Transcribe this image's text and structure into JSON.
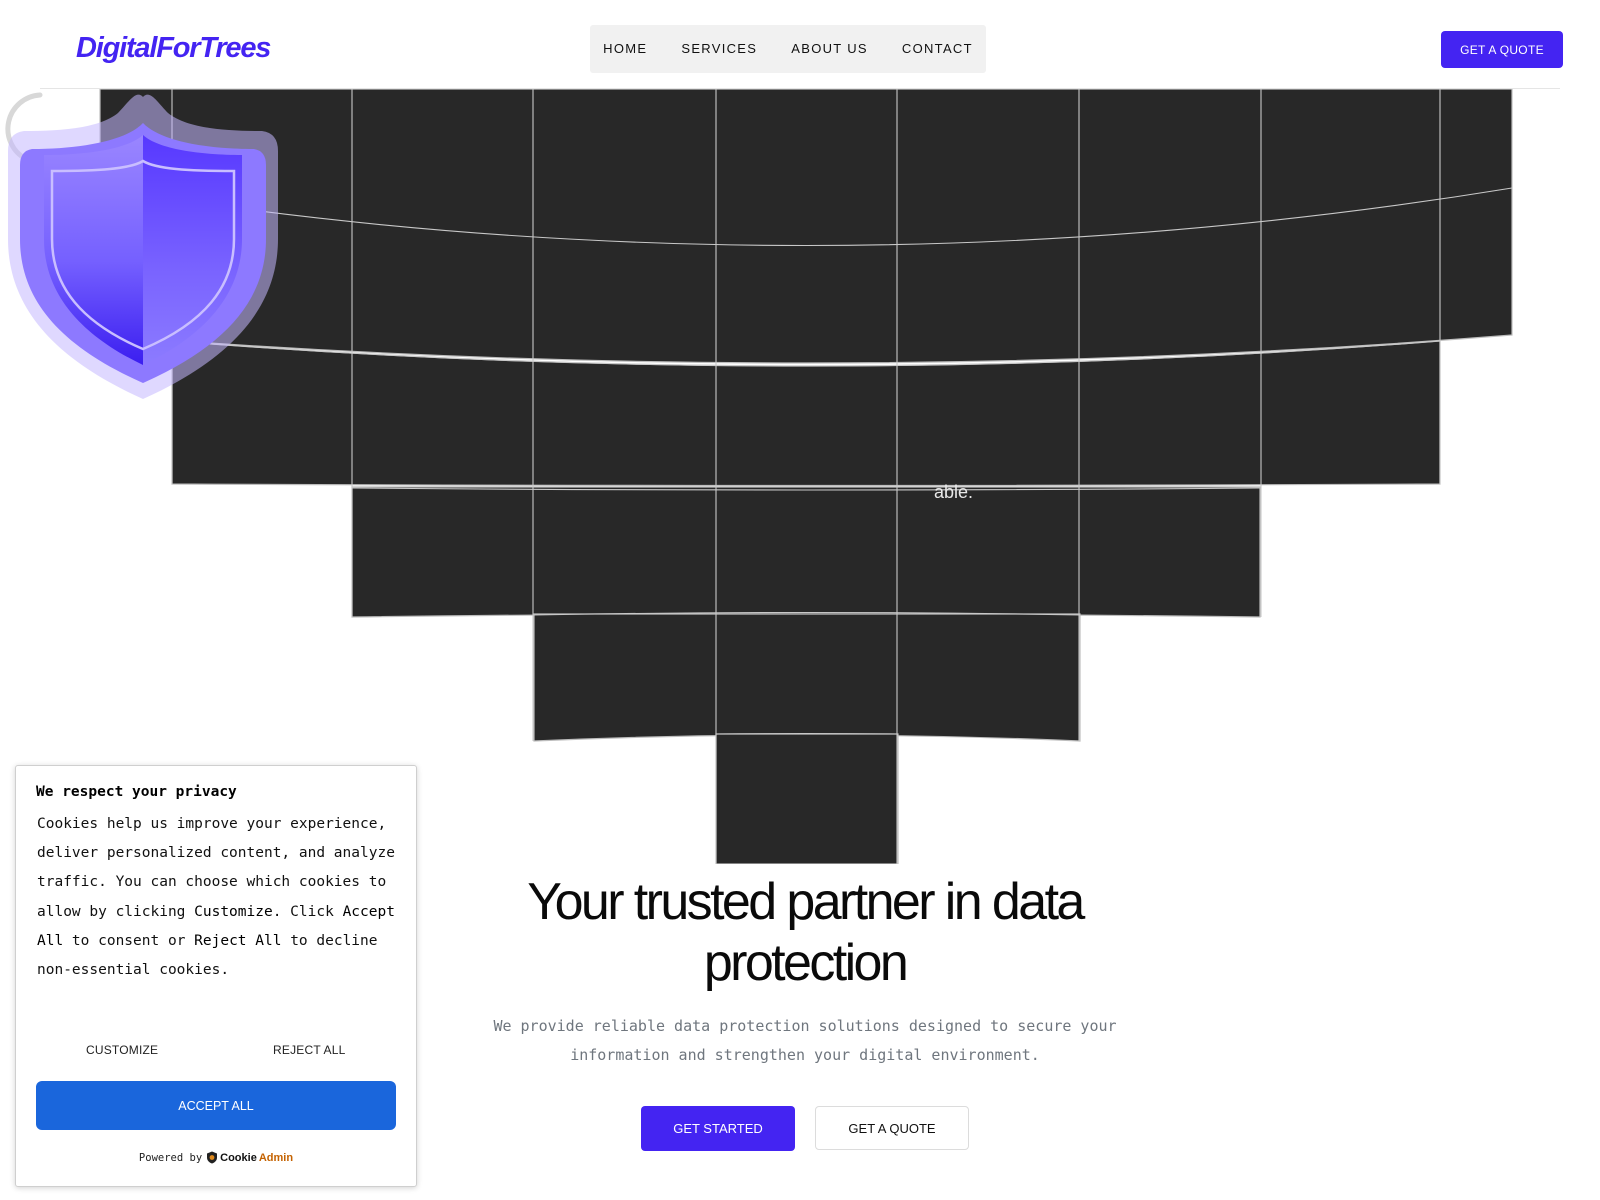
{
  "brand": {
    "logo_text": "DigitalForTrees",
    "accent_color": "#4424f2"
  },
  "nav": {
    "items": [
      {
        "label": "HOME"
      },
      {
        "label": "SERVICES"
      },
      {
        "label": "ABOUT US"
      },
      {
        "label": "CONTACT"
      }
    ],
    "quote_button": "GET A QUOTE"
  },
  "hero": {
    "partial_text": "able.",
    "shield_icon": "shield-icon",
    "title": "Your trusted partner in data protection",
    "subtitle": "We provide reliable data protection solutions designed to secure your information and strengthen your digital environment.",
    "primary_button": "GET STARTED",
    "secondary_button": "GET A QUOTE"
  },
  "cookie_banner": {
    "title": "We respect your privacy",
    "body_part1": "Cookies help us improve your experience, deliver personalized content, and analyze traffic. You can choose which cookies to allow by clicking ",
    "body_customize": "Customize",
    "body_part2": ". Click ",
    "body_accept": "Accept All",
    "body_part3": " to consent or ",
    "body_reject": "Reject All",
    "body_part4": " to decline non-essential cookies.",
    "customize_button": "CUSTOMIZE",
    "reject_button": "REJECT ALL",
    "accept_button": "ACCEPT ALL",
    "powered_by": "Powered by",
    "brand_part1": "Cookie",
    "brand_part2": "Admin",
    "accept_color": "#1a66dc"
  }
}
